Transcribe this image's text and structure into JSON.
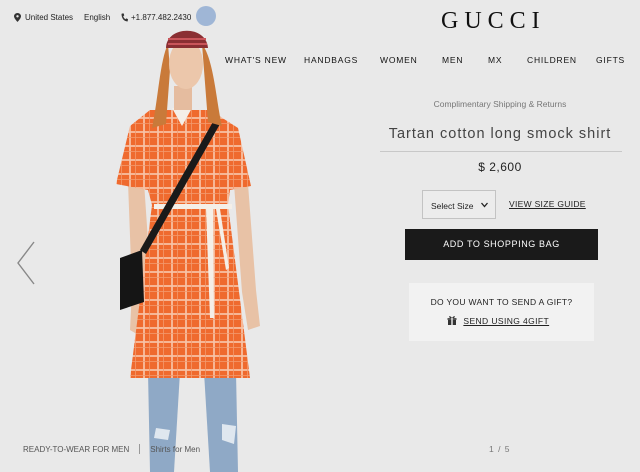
{
  "topbar": {
    "country": "United States",
    "language": "English",
    "phone": "+1.877.482.2430"
  },
  "brand": {
    "logo": "GUCCI"
  },
  "nav": {
    "items": [
      "WHAT'S NEW",
      "HANDBAGS",
      "WOMEN",
      "MEN",
      "MX",
      "CHILDREN",
      "GIFTS"
    ]
  },
  "product": {
    "shipping": "Complimentary Shipping & Returns",
    "title": "Tartan cotton long smock shirt",
    "price": "$ 2,600",
    "size_select": "Select Size",
    "size_guide": "VIEW SIZE GUIDE",
    "add_to_bag": "ADD TO SHOPPING BAG",
    "colors": {
      "accent": "#1a1a1a",
      "garment": "#ef6a2e"
    }
  },
  "gift": {
    "question": "DO YOU WANT TO SEND A GIFT?",
    "link": "SEND USING 4GIFT",
    "icon": "gift-icon"
  },
  "breadcrumb": {
    "items": [
      "READY-TO-WEAR FOR MEN",
      "Shirts for Men"
    ]
  },
  "gallery": {
    "pager": "1 / 5"
  },
  "icons": {
    "location": "map-pin-icon",
    "phone": "phone-icon",
    "prev": "chevron-left-icon",
    "dropdown": "chevron-down-icon"
  }
}
